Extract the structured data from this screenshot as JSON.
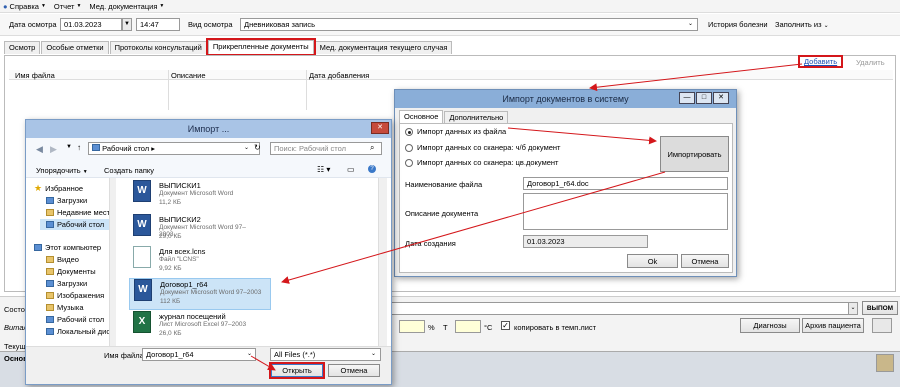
{
  "menu": {
    "help": "Справка",
    "report": "Отчет",
    "meddoc": "Мед. документация"
  },
  "header": {
    "date_label": "Дата осмотра",
    "date_value": "01.03.2023",
    "time_value": "14:47",
    "type_label": "Вид осмотра",
    "type_value": "Дневниковая запись",
    "history_link": "История болезни",
    "fill_from": "Заполнить из"
  },
  "tabs": [
    "Осмотр",
    "Особые отметки",
    "Протоколы консультаций",
    "Прикрепленные документы",
    "Мед. документация текущего случая"
  ],
  "docs": {
    "add": "Добавить",
    "remove": "Удалить",
    "cols": [
      "Имя файла",
      "Описание",
      "Дата добавления"
    ]
  },
  "importsys": {
    "title": "Импорт документов в систему",
    "tab1": "Основное",
    "tab2": "Дополнительно",
    "radio1": "Импорт данных из файла",
    "radio2": "Импорт данных со сканера: ч/б документ",
    "radio3": "Импорт данных со сканера: цв.документ",
    "import_btn": "Импортировать",
    "fname_label": "Наименование файла",
    "fname_value": "Договор1_r64.doc",
    "desc_label": "Описание документа",
    "date_label": "Дата создания",
    "date_value": "01.03.2023",
    "ok": "Ok",
    "cancel": "Отмена"
  },
  "filedlg": {
    "title": "Импорт ...",
    "path": "Рабочий стол",
    "search_ph": "Поиск: Рабочий стол",
    "organize": "Упорядочить",
    "new_folder": "Создать папку",
    "sidebar": [
      "Избранное",
      "Загрузки",
      "Недавние места",
      "Рабочий стол",
      "Этот компьютер",
      "Видео",
      "Документы",
      "Загрузки",
      "Изображения",
      "Музыка",
      "Рабочий стол",
      "Локальный диск"
    ],
    "files": [
      {
        "name": "ВЫПИСКИ1",
        "type": "Документ Microsoft Word",
        "size": "11,2 КБ"
      },
      {
        "name": "ВЫПИСКИ2",
        "type": "Документ Microsoft Word 97–2003",
        "size": "29,0 КБ"
      },
      {
        "name": "Для всех.lcns",
        "type": "Файл \"LCNS\"",
        "size": "9,92 КБ"
      },
      {
        "name": "Договор1_r64",
        "type": "Документ Microsoft Word 97–2003",
        "size": "112 КБ"
      },
      {
        "name": "журнал посещений",
        "type": "Лист Microsoft Excel 97–2003",
        "size": "26,0 КБ"
      }
    ],
    "fname_label": "Имя файла:",
    "fname_value": "Договор1_r64",
    "filter": "All Files (*.*)",
    "open": "Открыть",
    "cancel": "Отмена"
  },
  "bottom": {
    "state_label": "Состо",
    "vital_label": "Витал",
    "percent": "%",
    "t_label": "T",
    "celsius": "°C",
    "copy_label": "копировать в темп.лист",
    "diag": "Диагнозы",
    "archive": "Архив пациента",
    "cur_label": "Текущ",
    "main_label": "Основ",
    "vlpom": "ВЫПОМ"
  },
  "colors": {
    "accent_red": "#d4171b",
    "titlebar": "#8aaed8",
    "word": "#2b579a",
    "excel": "#217346"
  }
}
